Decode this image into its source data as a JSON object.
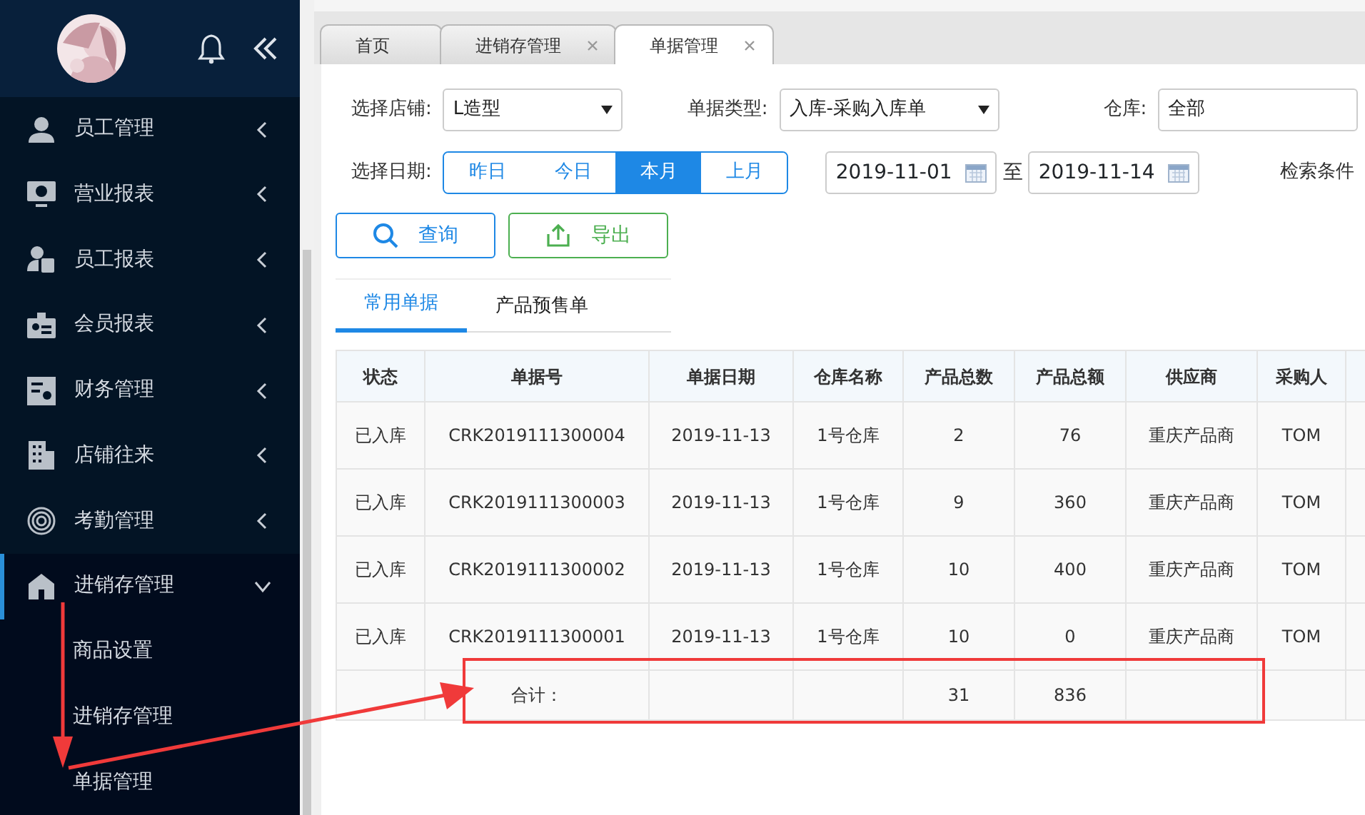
{
  "sidebar": {
    "menu": [
      {
        "label": "员工管理",
        "expanded": false
      },
      {
        "label": "营业报表",
        "expanded": false
      },
      {
        "label": "员工报表",
        "expanded": false
      },
      {
        "label": "会员报表",
        "expanded": false
      },
      {
        "label": "财务管理",
        "expanded": false
      },
      {
        "label": "店铺往来",
        "expanded": false
      },
      {
        "label": "考勤管理",
        "expanded": false
      },
      {
        "label": "进销存管理",
        "expanded": true,
        "children": [
          {
            "label": "商品设置"
          },
          {
            "label": "进销存管理"
          },
          {
            "label": "单据管理"
          }
        ]
      }
    ]
  },
  "tabs": [
    {
      "label": "首页",
      "closable": false,
      "selected": false
    },
    {
      "label": "进销存管理",
      "closable": true,
      "selected": false
    },
    {
      "label": "单据管理",
      "closable": true,
      "selected": true
    }
  ],
  "filters": {
    "store": {
      "label": "选择店铺:",
      "value": "L造型"
    },
    "bill_type": {
      "label": "单据类型:",
      "value": "入库-采购入库单"
    },
    "warehouse": {
      "label": "仓库:",
      "value": "全部"
    },
    "date": {
      "label": "选择日期:",
      "ranges": [
        {
          "label": "昨日",
          "selected": false
        },
        {
          "label": "今日",
          "selected": false
        },
        {
          "label": "本月",
          "selected": true
        },
        {
          "label": "上月",
          "selected": false
        }
      ],
      "from": "2019-11-01",
      "separator": "至",
      "to": "2019-11-14"
    },
    "search_conditions": "检索条件"
  },
  "buttons": [
    {
      "kind": "search",
      "label": "查询"
    },
    {
      "kind": "export",
      "label": "导出"
    }
  ],
  "subtabs": [
    {
      "label": "常用单据",
      "selected": true
    },
    {
      "label": "产品预售单",
      "selected": false
    }
  ],
  "table": {
    "columns": [
      "状态",
      "单据号",
      "单据日期",
      "仓库名称",
      "产品总数",
      "产品总额",
      "供应商",
      "采购人"
    ],
    "rows": [
      [
        "已入库",
        "CRK2019111300004",
        "2019-11-13",
        "1号仓库",
        "2",
        "76",
        "重庆产品商",
        "TOM"
      ],
      [
        "已入库",
        "CRK2019111300003",
        "2019-11-13",
        "1号仓库",
        "9",
        "360",
        "重庆产品商",
        "TOM"
      ],
      [
        "已入库",
        "CRK2019111300002",
        "2019-11-13",
        "1号仓库",
        "10",
        "400",
        "重庆产品商",
        "TOM"
      ],
      [
        "已入库",
        "CRK2019111300001",
        "2019-11-13",
        "1号仓库",
        "10",
        "0",
        "重庆产品商",
        "TOM"
      ]
    ],
    "total": {
      "label": "合计：",
      "quantity": "31",
      "amount": "836"
    }
  }
}
